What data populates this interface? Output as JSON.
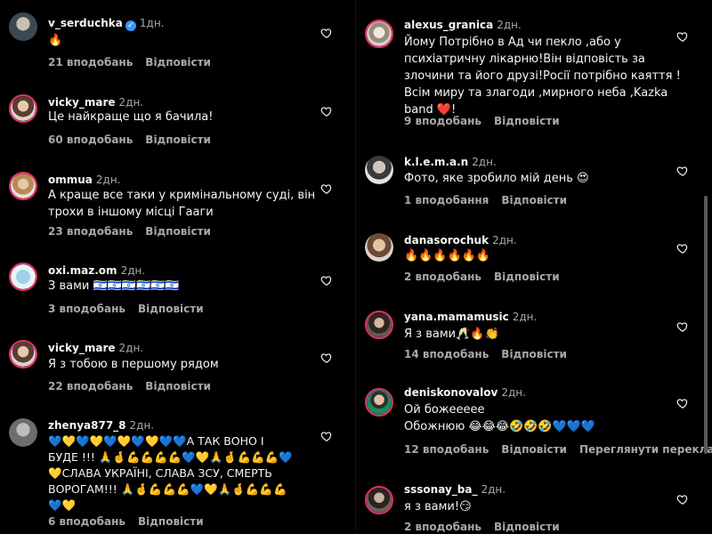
{
  "left_comments": [
    {
      "username": "v_serduchka",
      "verified": true,
      "time": "1дн.",
      "text": "🔥",
      "likes": "21 вподобань",
      "reply": "Відповісти"
    },
    {
      "username": "vicky_mare",
      "verified": false,
      "time": "2дн.",
      "text": "Це найкраще що я бачила!",
      "likes": "60 вподобань",
      "reply": "Відповісти"
    },
    {
      "username": "ommua",
      "verified": false,
      "time": "2дн.",
      "text": "А краще все таки у кримінальному суді, він трохи в іншому місці Гааги",
      "likes": "23 вподобань",
      "reply": "Відповісти"
    },
    {
      "username": "oxi.maz.om",
      "verified": false,
      "time": "2дн.",
      "text": "З вами 🇮🇱🇮🇱🇮🇱🇮🇱🇮🇱🇮🇱",
      "likes": "3 вподобань",
      "reply": "Відповісти"
    },
    {
      "username": "vicky_mare",
      "verified": false,
      "time": "2дн.",
      "text": "Я з тобою в першому рядом",
      "likes": "22 вподобань",
      "reply": "Відповісти"
    },
    {
      "username": "zhenya877_8",
      "verified": false,
      "time": "2дн.",
      "text": "💙💛💙💛💙💛💙💛💙💙А ТАК ВОНО І БУДЕ !!! 🙏🤞💪💪💪💪💙💛🙏🤞💪💪💪💙💛СЛАВА УКРАЇНІ, СЛАВА ЗСУ,  СМЕРТЬ ВОРОГАМ!!! 🙏🤞💪💪💪💙💛🙏🤞💪💪💪💙💛",
      "likes": "6 вподобань",
      "reply": "Відповісти"
    }
  ],
  "right_comments": [
    {
      "username": "alexus_granica",
      "time": "2дн.",
      "text": "Йому Потрібно в Ад чи пекло ,або у психіатричну лікарню!Він відповість за злочини та його друзі!Росії потрібно каяття !Всім миру та злагоди ,мирного неба ,Kazka band ❤️!",
      "likes": "9 вподобань",
      "reply": "Відповісти"
    },
    {
      "username": "k.l.e.m.a.n",
      "time": "2дн.",
      "text": "Фото, яке зробило мій день 😍",
      "likes": "1 вподобання",
      "reply": "Відповісти"
    },
    {
      "username": "danasorochuk",
      "time": "2дн.",
      "text": "🔥🔥🔥🔥🔥🔥",
      "likes": "2 вподобань",
      "reply": "Відповісти"
    },
    {
      "username": "yana.mamamusic",
      "time": "2дн.",
      "text": "Я з вами🥂🔥👏",
      "likes": "14 вподобань",
      "reply": "Відповісти"
    },
    {
      "username": "deniskonovalov",
      "time": "2дн.",
      "text": "Ой божеееее\nОбожнюю 😂😂😂🤣🤣🤣💙💙💙",
      "likes": "12 вподобань",
      "reply": "Відповісти",
      "translate": "Переглянути переклад"
    },
    {
      "username": "sssonay_ba_",
      "time": "2дн.",
      "text": "я з вами!😏",
      "likes": "2 вподобань",
      "reply": "Відповісти"
    }
  ],
  "colors": {
    "background": "#000000",
    "text": "#f5f5f5",
    "muted": "#a8a8a8",
    "story_ring": "#e1306c",
    "verified": "#3897f0"
  }
}
